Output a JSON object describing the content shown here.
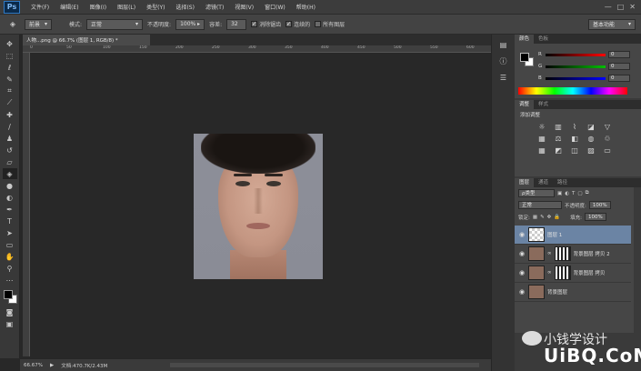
{
  "app": {
    "logo": "Ps"
  },
  "menu": [
    "文件(F)",
    "编辑(E)",
    "图像(I)",
    "图层(L)",
    "类型(Y)",
    "选择(S)",
    "滤镜(T)",
    "视图(V)",
    "窗口(W)",
    "帮助(H)"
  ],
  "window_controls": [
    "—",
    "□",
    "✕"
  ],
  "options": {
    "brush_preset": "前景",
    "mode_label": "模式:",
    "mode_value": "正常",
    "opacity_label": "不透明度:",
    "opacity_value": "100%",
    "tolerance_label": "容差:",
    "tolerance_value": "32",
    "anti_alias": "消除锯齿",
    "contiguous": "连续的",
    "all_layers": "所有图层",
    "workspace": "基本功能"
  },
  "document": {
    "tab_title": "人物...png @ 66.7% (图层 1, RGB/8) *"
  },
  "ruler_ticks": [
    "0",
    "50",
    "100",
    "150",
    "200",
    "250",
    "300",
    "350",
    "400",
    "450",
    "500",
    "550",
    "600"
  ],
  "status": {
    "zoom": "66.67%",
    "doc": "文档:470.7K/2.43M"
  },
  "color_panel": {
    "tabs": [
      "颜色",
      "色板"
    ],
    "channels": [
      {
        "label": "R",
        "value": "0",
        "color": "#ff0000"
      },
      {
        "label": "G",
        "value": "0",
        "color": "#00c000"
      },
      {
        "label": "B",
        "value": "0",
        "color": "#0000ff"
      }
    ]
  },
  "adjustments_panel": {
    "tabs": [
      "调整",
      "样式"
    ],
    "title": "添加调整",
    "icons": [
      "brightness-icon",
      "levels-icon",
      "curves-icon",
      "exposure-icon",
      "vibrance-icon",
      "hue-sat-icon",
      "color-balance-icon",
      "black-white-icon",
      "photo-filter-icon",
      "channel-mixer-icon",
      "color-lookup-icon",
      "invert-icon",
      "posterize-icon",
      "threshold-icon",
      "gradient-map-icon"
    ]
  },
  "layers_panel": {
    "tabs": [
      "图层",
      "通道",
      "路径"
    ],
    "filter": "ρ类型",
    "blend_mode": "正常",
    "opacity_label": "不透明度:",
    "opacity_value": "100%",
    "lock_label": "锁定:",
    "fill_label": "填充:",
    "fill_value": "100%",
    "layers": [
      {
        "name": "图层 1",
        "selected": true
      },
      {
        "name": "背景图层 拷贝 2",
        "selected": false
      },
      {
        "name": "背景图层 拷贝",
        "selected": false
      },
      {
        "name": "背景图层",
        "selected": false
      }
    ]
  },
  "watermark": {
    "text": "小钱学设计",
    "logo": "UiBQ.CoM"
  }
}
